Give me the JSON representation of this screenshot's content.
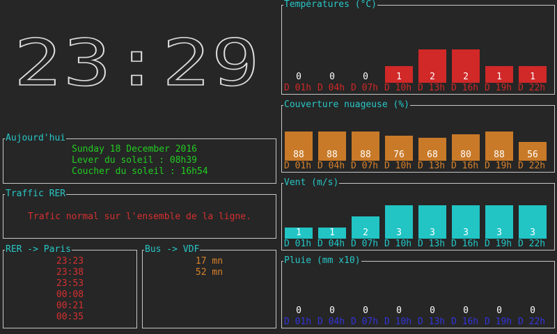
{
  "clock": {
    "time": "23:29"
  },
  "today": {
    "title": "Aujourd'hui",
    "date": "Sunday 18 December 2016",
    "sunrise": "Lever du soleil : 08h39",
    "sunset": "Coucher du soleil : 16h54"
  },
  "traffic": {
    "title": "Traffic RER",
    "message": "Trafic normal sur l'ensemble de la ligne."
  },
  "rer": {
    "title": "RER -> Paris",
    "times": [
      "23:23",
      "23:38",
      "23:53",
      "00:08",
      "00:21",
      "00:35"
    ]
  },
  "bus": {
    "title": "Bus -> VDF",
    "times": [
      "17 mn",
      "52 mn"
    ]
  },
  "colors": {
    "border": "#c8c8c8",
    "title": "#29c7c7",
    "green": "#22cc22",
    "red": "#d63030",
    "orange": "#d9822b",
    "cyan": "#22c8c8",
    "blue": "#3333dd",
    "white": "#ffffff"
  },
  "chart_data": [
    {
      "type": "bar",
      "name": "temperature",
      "title": "Températures (°C)",
      "categories": [
        "D 01h",
        "D 04h",
        "D 07h",
        "D 10h",
        "D 13h",
        "D 16h",
        "D 19h",
        "D 22h"
      ],
      "values": [
        0,
        0,
        0,
        1,
        2,
        2,
        1,
        1
      ],
      "ylim": [
        0,
        2
      ],
      "bar_color": "#d12828",
      "label_color": "#d12828"
    },
    {
      "type": "bar",
      "name": "clouds",
      "title": "Couverture nuageuse (%)",
      "categories": [
        "D 01h",
        "D 04h",
        "D 07h",
        "D 10h",
        "D 13h",
        "D 16h",
        "D 19h",
        "D 22h"
      ],
      "values": [
        88,
        88,
        88,
        76,
        68,
        80,
        88,
        56
      ],
      "ylim": [
        0,
        100
      ],
      "bar_color": "#c97a28",
      "label_color": "#d9822b"
    },
    {
      "type": "bar",
      "name": "wind",
      "title": "Vent (m/s)",
      "categories": [
        "D 01h",
        "D 04h",
        "D 07h",
        "D 10h",
        "D 13h",
        "D 16h",
        "D 19h",
        "D 22h"
      ],
      "values": [
        1,
        1,
        2,
        3,
        3,
        3,
        3,
        3
      ],
      "ylim": [
        0,
        3
      ],
      "bar_color": "#22c4c4",
      "label_color": "#22c8c8"
    },
    {
      "type": "bar",
      "name": "rain",
      "title": "Pluie (mm x10)",
      "categories": [
        "D 01h",
        "D 04h",
        "D 07h",
        "D 10h",
        "D 13h",
        "D 16h",
        "D 19h",
        "D 22h"
      ],
      "values": [
        0,
        0,
        0,
        0,
        0,
        0,
        0,
        0
      ],
      "ylim": [
        0,
        10
      ],
      "bar_color": "#3333dd",
      "label_color": "#3333dd"
    }
  ]
}
